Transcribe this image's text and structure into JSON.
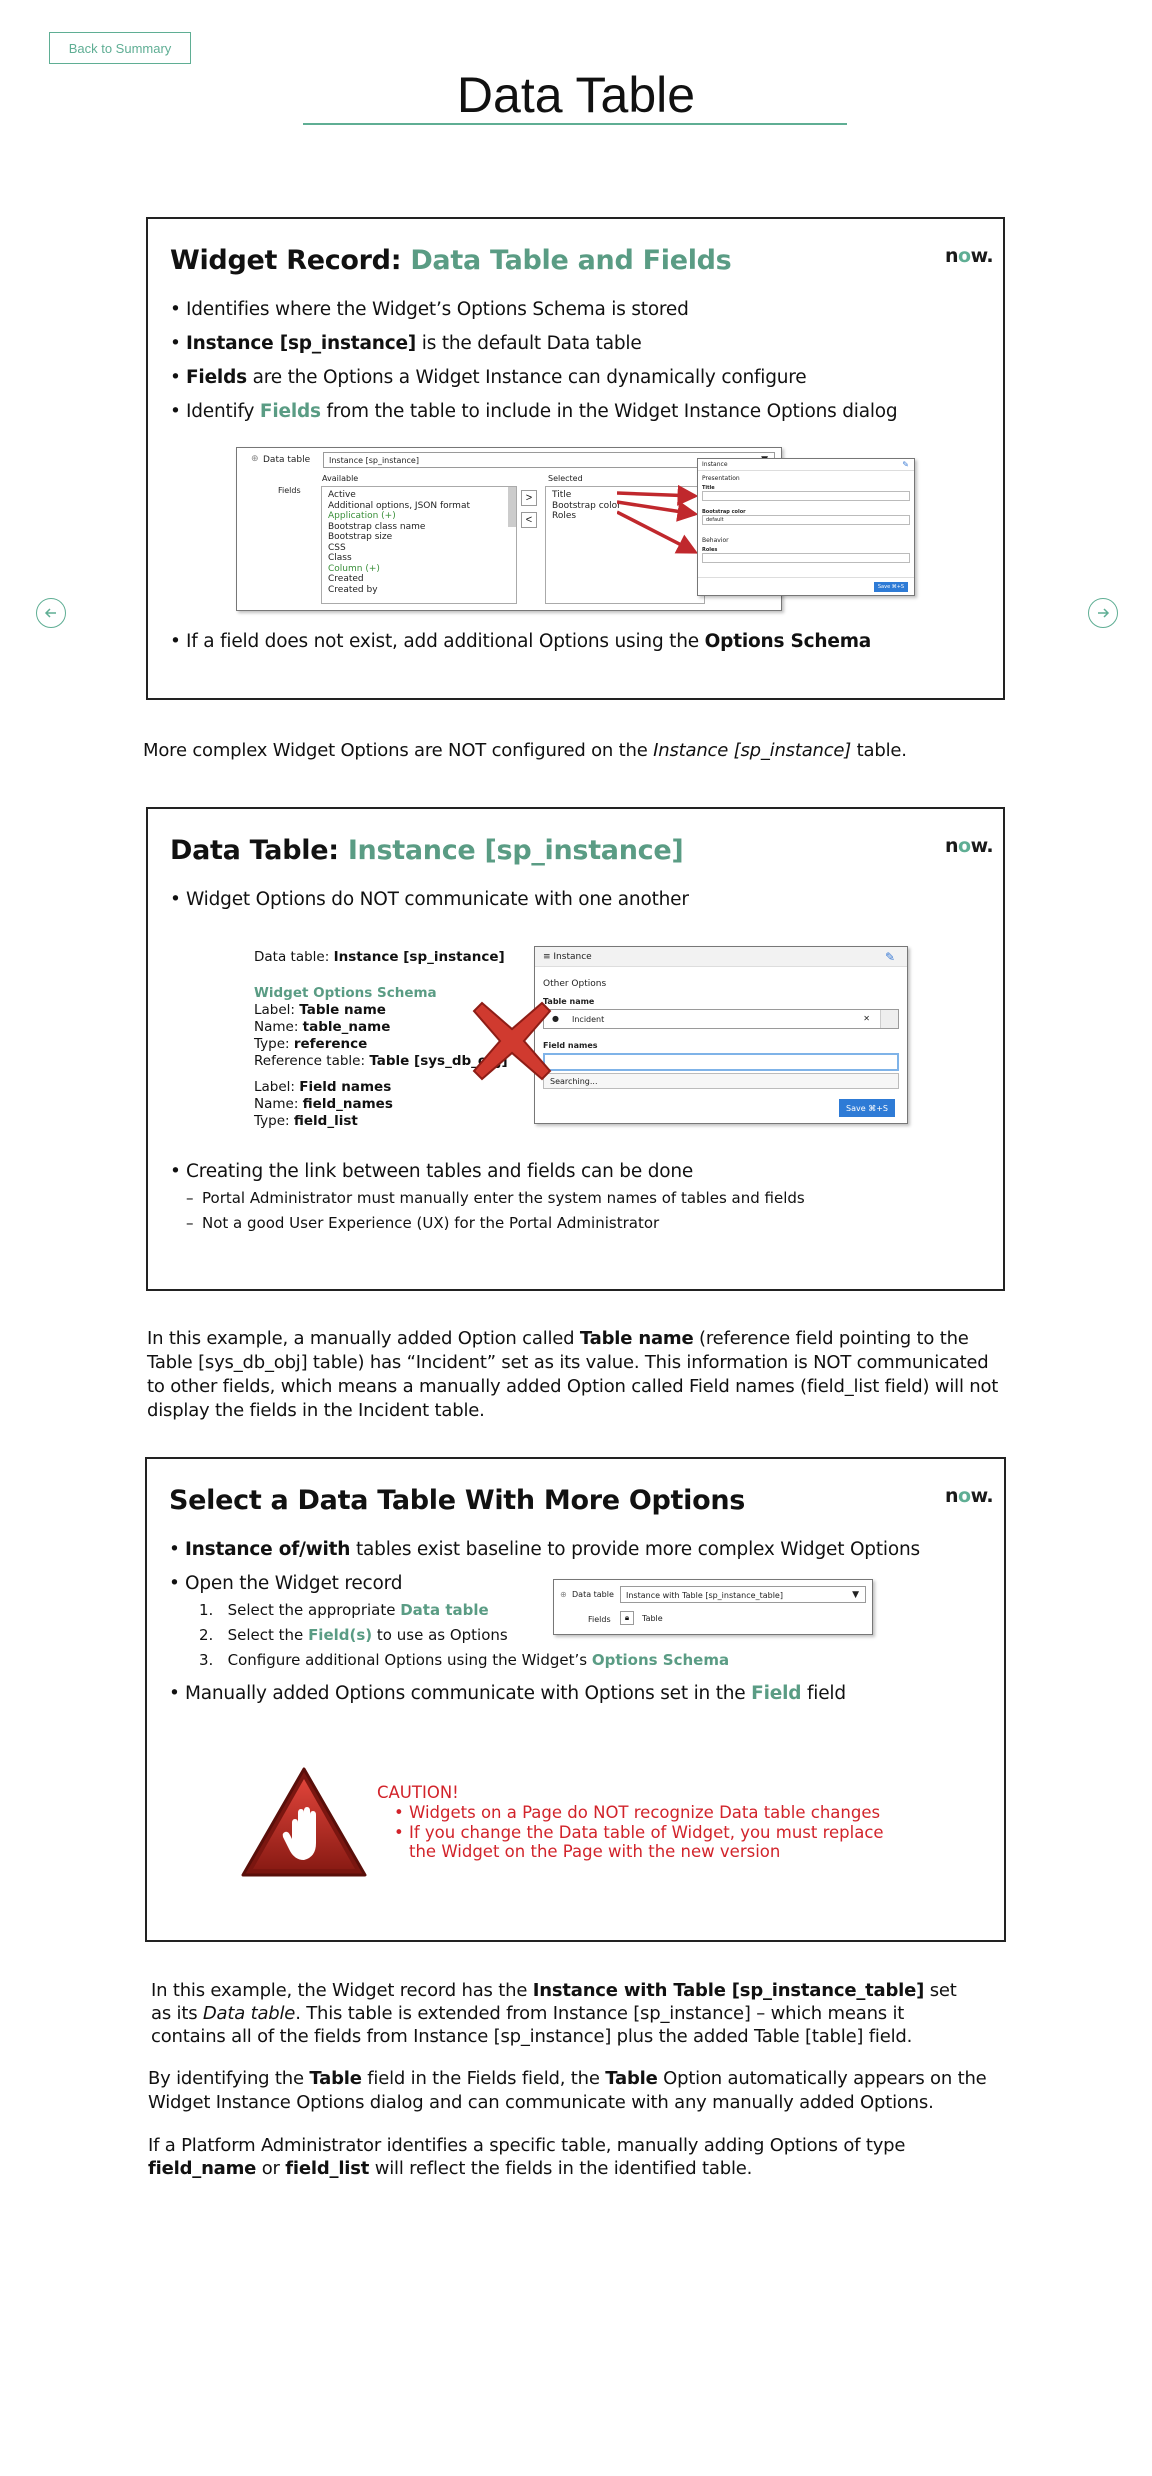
{
  "header": {
    "back_label": "Back to Summary",
    "title": "Data Table"
  },
  "nav": {
    "prev_icon": "arrow-left-circle-icon",
    "next_icon": "arrow-right-circle-icon"
  },
  "colors": {
    "accent": "#5fae94",
    "slide_accent": "#5a9c84",
    "caution": "#d2232a"
  },
  "slide1": {
    "title_prefix": "Widget Record: ",
    "title_accent": "Data Table and Fields",
    "logo": "now.",
    "b1": "Identifies where the Widget’s Options Schema is stored",
    "b2_bold": "Instance [sp_instance]",
    "b2_rest": " is the default Data table",
    "b3_bold": "Fields",
    "b3_rest": " are the Options a Widget Instance can dynamically configure",
    "b4_pre": "Identify ",
    "b4_green": "Fields",
    "b4_rest": " from the table to include in the Widget Instance Options dialog",
    "b5_pre": "If a field does not exist, add additional Options using the ",
    "b5_bold": "Options Schema",
    "shot": {
      "data_table_label": "Data table",
      "data_table_value": "Instance [sp_instance]",
      "fields_label": "Fields",
      "available_label": "Available",
      "selected_label": "Selected",
      "available": [
        "Active",
        "Additional options, JSON format",
        "Application (+)",
        "Bootstrap class name",
        "Bootstrap size",
        "CSS",
        "Class",
        "Column (+)",
        "Created",
        "Created by"
      ],
      "selected": [
        "Title",
        "Bootstrap color",
        "Roles"
      ],
      "move_right": ">",
      "move_left": "<",
      "dialog": {
        "header": "Instance",
        "section1": "Presentation",
        "f1": "Title",
        "f2": "Bootstrap color",
        "f2_value": "default",
        "section2": "Behavior",
        "f3": "Roles",
        "save": "Save ⌘+S"
      }
    }
  },
  "para1": {
    "pre": "More complex Widget Options are NOT configured on the ",
    "italic": "Instance [sp_instance]",
    "post": " table."
  },
  "slide2": {
    "title_prefix": "Data Table: ",
    "title_accent": "Instance [sp_instance]",
    "logo": "now.",
    "b1": "Widget Options do NOT communicate with one another",
    "info": {
      "dt_label": "Data table: ",
      "dt_value": "Instance [sp_instance]",
      "schema": "Widget Options Schema",
      "l1_label": "Label: ",
      "l1_value": "Table name",
      "l2_label": "Name: ",
      "l2_value": "table_name",
      "l3_label": "Type: ",
      "l3_value": "reference",
      "l4_label": "Reference table: ",
      "l4_value": "Table [sys_db_obj]",
      "l5_label": "Label: ",
      "l5_value": "Field names",
      "l6_label": "Name: ",
      "l6_value": "field_names",
      "l7_label": "Type: ",
      "l7_value": "field_list"
    },
    "dialog": {
      "header": "Instance",
      "section": "Other Options",
      "f1": "Table name",
      "f1_value": "Incident",
      "f2": "Field names",
      "searching": "Searching...",
      "save": "Save ⌘+S"
    },
    "b2": "Creating the link between tables and fields can be done",
    "s1": "Portal Administrator must manually enter the system names of tables and fields",
    "s2": "Not a good User Experience (UX) for the Portal Administrator"
  },
  "para2": {
    "p1": "In this example, a manually added Option called ",
    "b1": "Table name",
    "p2": " (reference field pointing to the Table [sys_db_obj] table) has “Incident” set as its value. This information is NOT communicated to other fields, which means a manually added Option called Field names (field_list field) will not display the fields in the Incident table."
  },
  "slide3": {
    "title": "Select a Data Table With More Options",
    "logo": "now.",
    "b1_bold": "Instance of/with",
    "b1_rest": " tables exist baseline to provide more complex Widget Options",
    "b2": "Open the Widget record",
    "n1_pre": "Select the appropriate ",
    "n1_green": "Data table",
    "n2_pre": "Select the ",
    "n2_green": "Field(s)",
    "n2_rest": " to use as Options",
    "n3_pre": "Configure additional Options using the Widget’s ",
    "n3_green": "Options Schema",
    "b3_pre": "Manually added Options communicate with Options set in the ",
    "b3_green": "Field",
    "b3_rest": " field",
    "shot": {
      "dt_label": "Data table",
      "dt_value": "Instance with Table [sp_instance_table]",
      "fields_label": "Fields",
      "fields_value": "Table"
    },
    "caution": {
      "title": "CAUTION!",
      "c1": "Widgets on a Page do NOT recognize Data table changes",
      "c2": "If you change the Data table of Widget, you must replace the Widget on the Page with the new version"
    }
  },
  "para3": {
    "p1": "In this example, the Widget record has the ",
    "b1": "Instance with Table [sp_instance_table]",
    "p2": " set as its ",
    "i1": "Data table",
    "p3": ". This table is extended from Instance [sp_instance] – which means it contains all of the fields from Instance [sp_instance] plus the added Table [table] field."
  },
  "para4": {
    "p1": "By identifying the ",
    "b1": "Table",
    "p2": " field in the Fields field, the ",
    "b2": "Table",
    "p3": " Option automatically appears on the Widget Instance Options dialog and can communicate with any manually added Options."
  },
  "para5": {
    "p1": "If a Platform Administrator identifies a specific table, manually adding Options of type ",
    "b1": "field_name",
    "p2": " or ",
    "b2": "field_list",
    "p3": " will reflect the fields in the identified table."
  }
}
